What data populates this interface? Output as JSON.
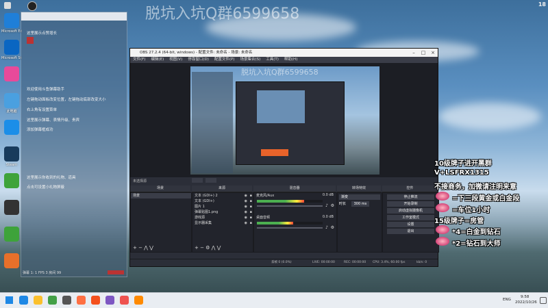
{
  "watermark": "脱坑入坑Q群6599658",
  "corner_number": "18",
  "desktop_icons": [
    {
      "label": "Microsoft Edge",
      "color": "#1f7fd8"
    },
    {
      "label": "Microsoft Store",
      "color": "#0a66c2"
    },
    {
      "label": "",
      "color": "#e84a9a"
    },
    {
      "label": "此电脑",
      "color": "#4aa0e0"
    },
    {
      "label": "",
      "color": "#1b8ee8"
    },
    {
      "label": "Steam",
      "color": "#183b5c"
    },
    {
      "label": "",
      "color": "#3ea33a"
    },
    {
      "label": "",
      "color": "#333333"
    },
    {
      "label": "",
      "color": "#3ea33a"
    },
    {
      "label": "",
      "color": "#e8702a"
    }
  ],
  "left_panel": {
    "lines": [
      "这里展示点赞增长",
      "欢迎使用斗鱼弹幕助手",
      "左键拖动面板改变位置，左键拖动底部改变大小",
      "右上角有设置菜单",
      "这里展示弹幕、表情升级、贵宾",
      "添加弹幕框成功",
      "这里展示你收到的礼物、道具",
      "点击可设置小礼物屏蔽"
    ],
    "footer": "弹幕 1: 1 FPS 3 房间 99"
  },
  "obs": {
    "title": "OBS 27.2.4 (64-bit, windows) - 配置文件: 未命名 - 场景: 未命名",
    "menu": [
      "文件(F)",
      "编辑(E)",
      "视图(V)",
      "停靠窗口(D)",
      "配置文件(P)",
      "场景集合(S)",
      "工具(T)",
      "帮助(H)"
    ],
    "preview_watermark": "脱坑入坑Q群6599658",
    "no_source": "未选择源",
    "docks": {
      "scenes": "场景",
      "sources": "来源",
      "mixer": "混音器",
      "transitions": "转场特效",
      "controls": "控件"
    },
    "scene_items": [
      "场景"
    ],
    "source_items": [
      "文本 (GDI+) 2",
      "文本 (GDI+)",
      "图片 1",
      "弹幕贴图1.png",
      "游戏源",
      "显示器采集"
    ],
    "mixer_tracks": [
      {
        "name": "麦克风/Aux",
        "db": "0.0 dB",
        "level": 0.72
      },
      {
        "name": "桌面音频",
        "db": "0.0 dB",
        "level": 0.55
      }
    ],
    "transition_type": "渐变",
    "duration_label": "时长",
    "duration_value": "300 ms",
    "control_buttons": [
      "停止推流",
      "开始录制",
      "启动虚拟摄像机",
      "工作室模式",
      "设置",
      "退出"
    ],
    "status": {
      "live": "LIVE: 00:00:00",
      "rec": "REC: 00:00:00",
      "cpu": "CPU: 3.4%, 60.00 fps",
      "dropped": "丢帧 0 (0.0%)",
      "kbps": "kb/s: 0"
    }
  },
  "overlay": {
    "lines": [
      "10级牌子进开黑群",
      "V+LSFRX1315",
      "不接商务，加微请注明来意",
      "=下三段黄金或白金段",
      "=车位1小时",
      "15级牌子=房管",
      "*4=白金到钻石",
      "*2=钻石到大师"
    ]
  },
  "taskbar": {
    "icons": [
      "#1e88e5",
      "#fbc02d",
      "#43a047",
      "#555555",
      "#ff7043",
      "#f4511e",
      "#7e57c2",
      "#ef5350",
      "#ff8a00"
    ],
    "lang": "ENG",
    "time": "9:58",
    "date": "2022/10/26"
  }
}
